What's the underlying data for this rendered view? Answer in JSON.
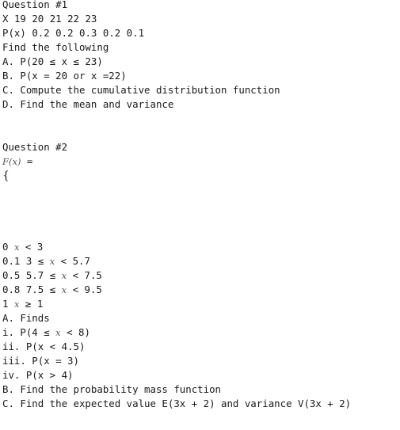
{
  "question1": {
    "title": "Question #1",
    "x_row_label": "X",
    "x_values": "19 20 21 22 23",
    "p_row_label": "P(x)",
    "p_values": "0.2 0.2 0.3 0.2 0.1",
    "instruction": "Find the following",
    "parts": [
      "A. P(20 ≤ x ≤ 23)",
      "B. P(x = 20 or x =22)",
      "C. Compute the cumulative distribution function",
      "D. Find the mean and variance"
    ]
  },
  "question2": {
    "title": "Question #2",
    "function_label": "F(x)",
    "equals": " =",
    "brace": "{",
    "cdf_rows": [
      {
        "value": "0",
        "pre": " ",
        "var": "x",
        "post": " < 3"
      },
      {
        "value": "0.1",
        "pre": " 3 ≤ ",
        "var": "x",
        "post": " < 5.7"
      },
      {
        "value": "0.5",
        "pre": " 5.7 ≤ ",
        "var": "x",
        "post": " < 7.5"
      },
      {
        "value": "0.8",
        "pre": " 7.5 ≤ ",
        "var": "x",
        "post": " < 9.5"
      },
      {
        "value": "1",
        "pre": " ",
        "var": "x",
        "post": " ≥ 1"
      }
    ],
    "part_a": {
      "title": "A. Finds",
      "items": [
        {
          "pre": "i. P(4 ≤ ",
          "var": "x",
          "post": " < 8)"
        },
        {
          "text": "ii. P(x < 4.5)"
        },
        {
          "text": "iii. P(x = 3)"
        },
        {
          "text": "iv. P(x > 4)"
        }
      ]
    },
    "part_b": "B. Find the probability mass function",
    "part_c": "C. Find the expected value E(3x + 2) and variance V(3x + 2)"
  }
}
